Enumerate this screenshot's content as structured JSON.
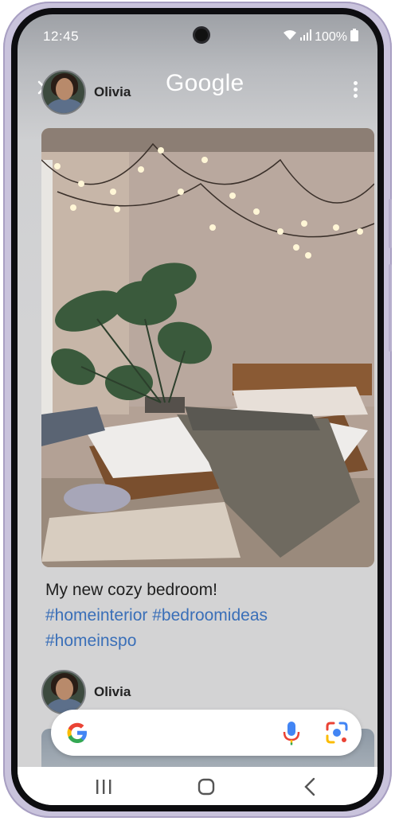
{
  "status_bar": {
    "time": "12:45",
    "battery": "100%"
  },
  "header": {
    "user_name": "Olivia",
    "brand": "Google"
  },
  "post": {
    "caption": "My new cozy bedroom!",
    "hashtags": "#homeinterior #bedroomideas #homeinspo"
  },
  "post2": {
    "user_name": "Olivia"
  },
  "icons": {
    "close": "close-icon",
    "menu": "more-vert-icon",
    "wifi": "wifi-icon",
    "signal": "signal-icon",
    "battery": "battery-icon",
    "google": "google-g-icon",
    "mic": "mic-icon",
    "lens": "google-lens-icon",
    "recents": "recents-icon",
    "home": "home-icon",
    "back": "back-icon"
  },
  "colors": {
    "hashtag": "#3a6fb8",
    "phone_frame": "#c9c3dc"
  }
}
